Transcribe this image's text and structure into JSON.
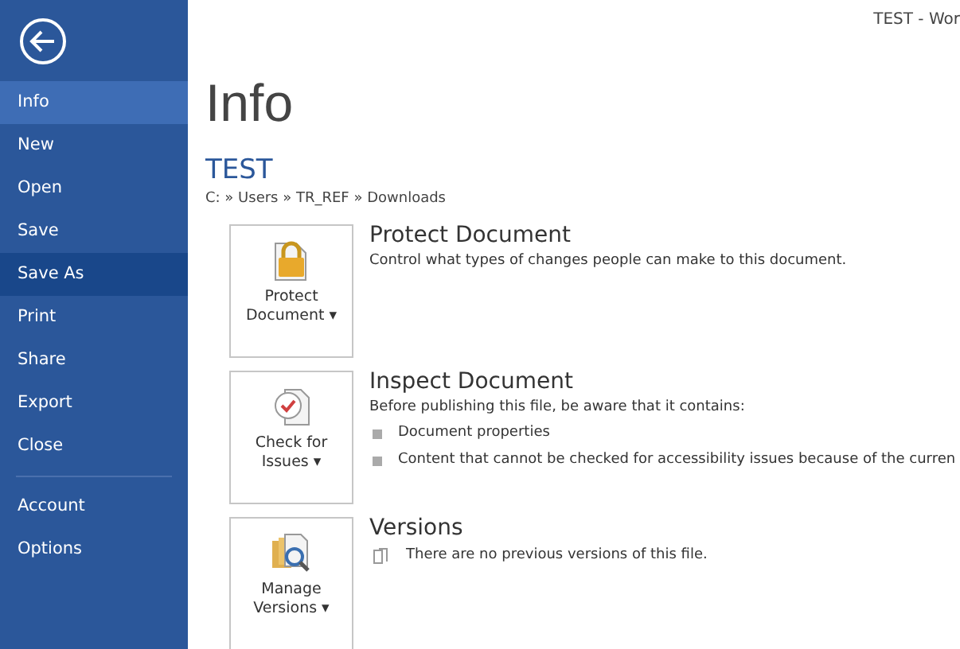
{
  "window": {
    "title": "TEST - Wor"
  },
  "sidebar": {
    "items": [
      {
        "label": "Info",
        "selected": true,
        "hover": false,
        "divider_before": false
      },
      {
        "label": "New",
        "selected": false,
        "hover": false,
        "divider_before": false
      },
      {
        "label": "Open",
        "selected": false,
        "hover": false,
        "divider_before": false
      },
      {
        "label": "Save",
        "selected": false,
        "hover": false,
        "divider_before": false
      },
      {
        "label": "Save As",
        "selected": false,
        "hover": true,
        "divider_before": false
      },
      {
        "label": "Print",
        "selected": false,
        "hover": false,
        "divider_before": false
      },
      {
        "label": "Share",
        "selected": false,
        "hover": false,
        "divider_before": false
      },
      {
        "label": "Export",
        "selected": false,
        "hover": false,
        "divider_before": false
      },
      {
        "label": "Close",
        "selected": false,
        "hover": false,
        "divider_before": false
      },
      {
        "label": "Account",
        "selected": false,
        "hover": false,
        "divider_before": true
      },
      {
        "label": "Options",
        "selected": false,
        "hover": false,
        "divider_before": false
      }
    ]
  },
  "heading": "Info",
  "document": {
    "name": "TEST",
    "path": "C: » Users » TR_REF » Downloads"
  },
  "sections": [
    {
      "kind": "protect",
      "button": [
        "Protect",
        "Document"
      ],
      "caret": "▾",
      "title": "Protect Document",
      "description": "Control what types of changes people can make to this document."
    },
    {
      "kind": "inspect",
      "button": [
        "Check for",
        "Issues"
      ],
      "caret": "▾",
      "title": "Inspect Document",
      "description": "Before publishing this file, be aware that it contains:",
      "bullets": [
        "Document properties",
        "Content that cannot be checked for accessibility issues because of the curren"
      ]
    },
    {
      "kind": "versions",
      "button": [
        "Manage",
        "Versions"
      ],
      "caret": "▾",
      "title": "Versions",
      "note": "There are no previous versions of this file."
    }
  ]
}
